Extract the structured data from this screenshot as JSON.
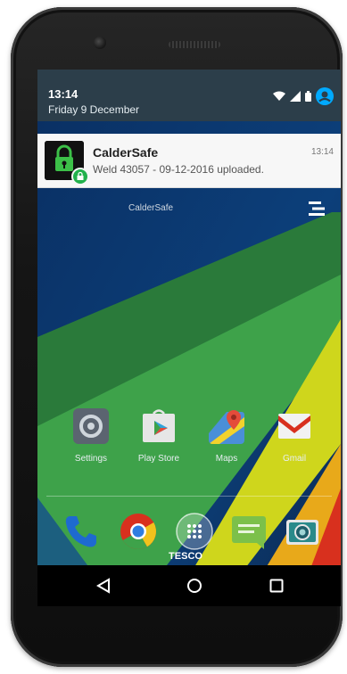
{
  "status_bar": {
    "time": "13:14",
    "date": "Friday 9 December",
    "icons": [
      "wifi-icon",
      "signal-icon",
      "battery-icon",
      "account-icon"
    ]
  },
  "notification": {
    "app_name": "CalderSafe",
    "message": "Weld 43057 - 09-12-2016 uploaded.",
    "time": "13:14",
    "icon": "lock-icon"
  },
  "home": {
    "widget_label": "CalderSafe",
    "apps": [
      {
        "label": "Settings",
        "icon": "settings-icon"
      },
      {
        "label": "Play Store",
        "icon": "play-store-icon"
      },
      {
        "label": "Maps",
        "icon": "maps-icon"
      },
      {
        "label": "Gmail",
        "icon": "gmail-icon"
      }
    ],
    "dock": [
      {
        "icon": "phone-icon"
      },
      {
        "icon": "chrome-icon"
      },
      {
        "icon": "app-drawer-icon",
        "label": "TESCO"
      },
      {
        "icon": "messages-icon"
      },
      {
        "icon": "camera-icon"
      }
    ]
  },
  "navbar": {
    "buttons": [
      "back-icon",
      "home-icon",
      "recents-icon"
    ]
  },
  "colors": {
    "shade": "#2c3e4a",
    "notification_bg": "#f7f7f7",
    "accent": "#00aaff"
  }
}
